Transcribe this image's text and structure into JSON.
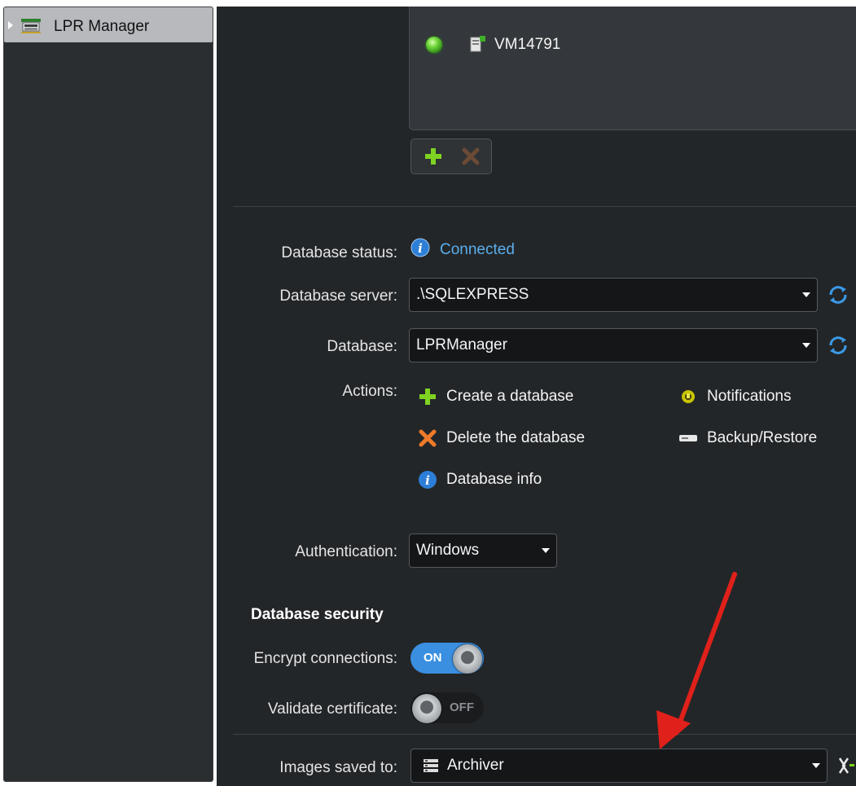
{
  "tree": {
    "selected_item_label": "LPR Manager"
  },
  "servers": {
    "items": [
      {
        "name": "VM14791",
        "status_color": "#47c22a"
      }
    ]
  },
  "database": {
    "status_label": "Database status:",
    "status_value": "Connected",
    "server_label": "Database server:",
    "server_value": ".\\SQLEXPRESS",
    "database_label": "Database:",
    "database_value": "LPRManager",
    "actions_label": "Actions:",
    "actions": {
      "create": "Create a database",
      "delete": "Delete the database",
      "info": "Database info",
      "notifications": "Notifications",
      "backup": "Backup/Restore"
    },
    "authentication_label": "Authentication:",
    "authentication_value": "Windows"
  },
  "security": {
    "title": "Database security",
    "encrypt_label": "Encrypt connections:",
    "encrypt_state": "ON",
    "validate_label": "Validate certificate:",
    "validate_state": "OFF"
  },
  "images": {
    "label": "Images saved to:",
    "value": "Archiver"
  },
  "colors": {
    "accent_blue": "#3a8fe0",
    "link_blue": "#5aaeee",
    "annotation_red": "#e0201a",
    "panel_bg": "#232628"
  }
}
